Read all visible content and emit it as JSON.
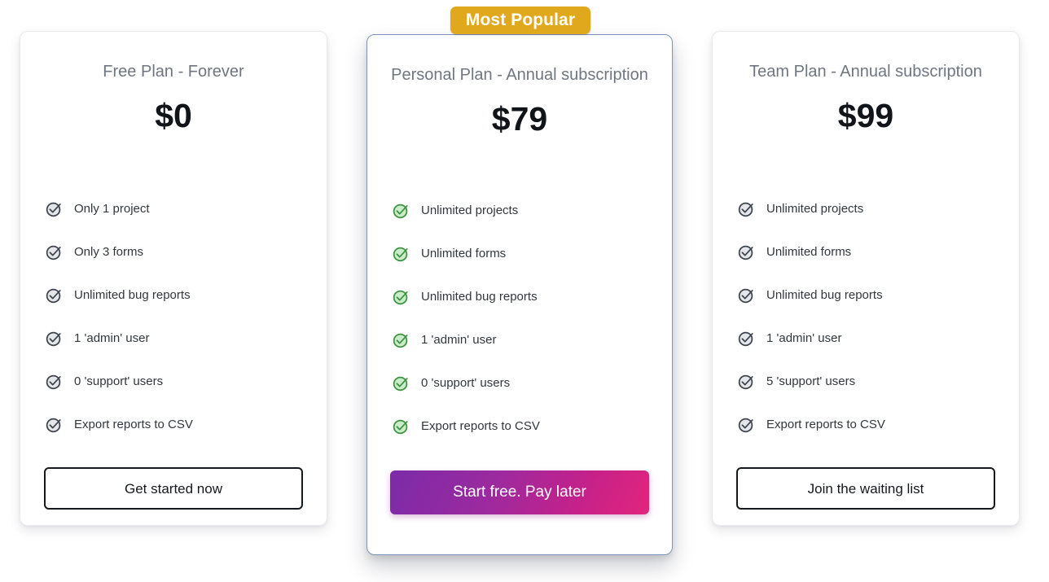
{
  "badge": {
    "label": "Most Popular",
    "color": "#e0a81c"
  },
  "plans": [
    {
      "id": "free",
      "title": "Free Plan - Forever",
      "price": "$0",
      "icon_name": "check-circle-icon",
      "icon_stroke": "#3d444c",
      "icon_fill": "#e4e6e9",
      "features": [
        "Only 1 project",
        "Only 3 forms",
        "Unlimited bug reports",
        "1 'admin' user",
        "0 'support' users",
        "Export reports to CSV"
      ],
      "cta": {
        "label": "Get started now",
        "style": "outline"
      }
    },
    {
      "id": "personal",
      "title": "Personal Plan - Annual subscription",
      "price": "$79",
      "featured": true,
      "icon_name": "check-circle-icon",
      "icon_stroke": "#3e9142",
      "icon_fill": "#c9edc9",
      "features": [
        "Unlimited projects",
        "Unlimited forms",
        "Unlimited bug reports",
        "1 'admin' user",
        "0 'support' users",
        "Export reports to CSV"
      ],
      "cta": {
        "label": "Start free. Pay later",
        "style": "gradient",
        "gradient_from": "#7b2ba8",
        "gradient_to": "#e2257c"
      }
    },
    {
      "id": "team",
      "title": "Team Plan - Annual subscription",
      "price": "$99",
      "icon_name": "check-circle-icon",
      "icon_stroke": "#3d444c",
      "icon_fill": "#e4e6e9",
      "features": [
        "Unlimited projects",
        "Unlimited forms",
        "Unlimited bug reports",
        "1 'admin' user",
        "5 'support' users",
        "Export reports to CSV"
      ],
      "cta": {
        "label": "Join the waiting list",
        "style": "outline"
      }
    }
  ]
}
